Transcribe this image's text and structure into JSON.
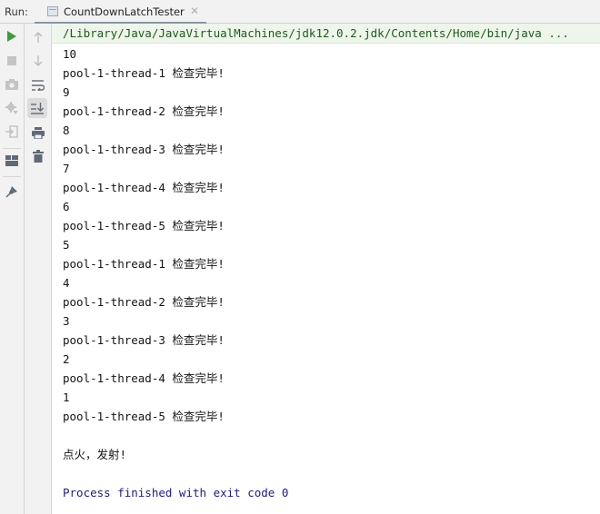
{
  "run_panel": {
    "label": "Run:",
    "tab": {
      "title": "CountDownLatchTester",
      "close_icon": "close-icon"
    }
  },
  "toolbar_left": [
    {
      "name": "run-icon",
      "tooltip": "Rerun"
    },
    {
      "name": "stop-icon",
      "tooltip": "Stop"
    },
    {
      "name": "camera-icon",
      "tooltip": "Dump Threads"
    },
    {
      "name": "settings-gear-icon",
      "tooltip": "Settings"
    },
    {
      "name": "exit-icon",
      "tooltip": "Exit"
    },
    {
      "name": "layout-icon",
      "tooltip": "Restore Layout"
    },
    {
      "name": "pin-icon",
      "tooltip": "Pin Tab"
    }
  ],
  "toolbar_right": [
    {
      "name": "arrow-up-icon"
    },
    {
      "name": "arrow-down-icon"
    },
    {
      "name": "soft-wrap-icon"
    },
    {
      "name": "scroll-to-end-icon",
      "active": true
    },
    {
      "name": "print-icon"
    },
    {
      "name": "trash-icon"
    }
  ],
  "console": {
    "command": "/Library/Java/JavaVirtualMachines/jdk12.0.2.jdk/Contents/Home/bin/java ...",
    "lines": [
      "10",
      "pool-1-thread-1 检查完毕!",
      "9",
      "pool-1-thread-2 检查完毕!",
      "8",
      "pool-1-thread-3 检查完毕!",
      "7",
      "pool-1-thread-4 检查完毕!",
      "6",
      "pool-1-thread-5 检查完毕!",
      "5",
      "pool-1-thread-1 检查完毕!",
      "4",
      "pool-1-thread-2 检查完毕!",
      "3",
      "pool-1-thread-3 检查完毕!",
      "2",
      "pool-1-thread-4 检查完毕!",
      "1",
      "pool-1-thread-5 检查完毕!",
      "",
      "点火，发射!",
      ""
    ],
    "exit_message": "Process finished with exit code 0"
  },
  "colors": {
    "command_text": "#1d5a1d",
    "command_bg": "#eef5ea",
    "exit_text": "#1d1d7a",
    "run_green": "#3d9a3d"
  }
}
